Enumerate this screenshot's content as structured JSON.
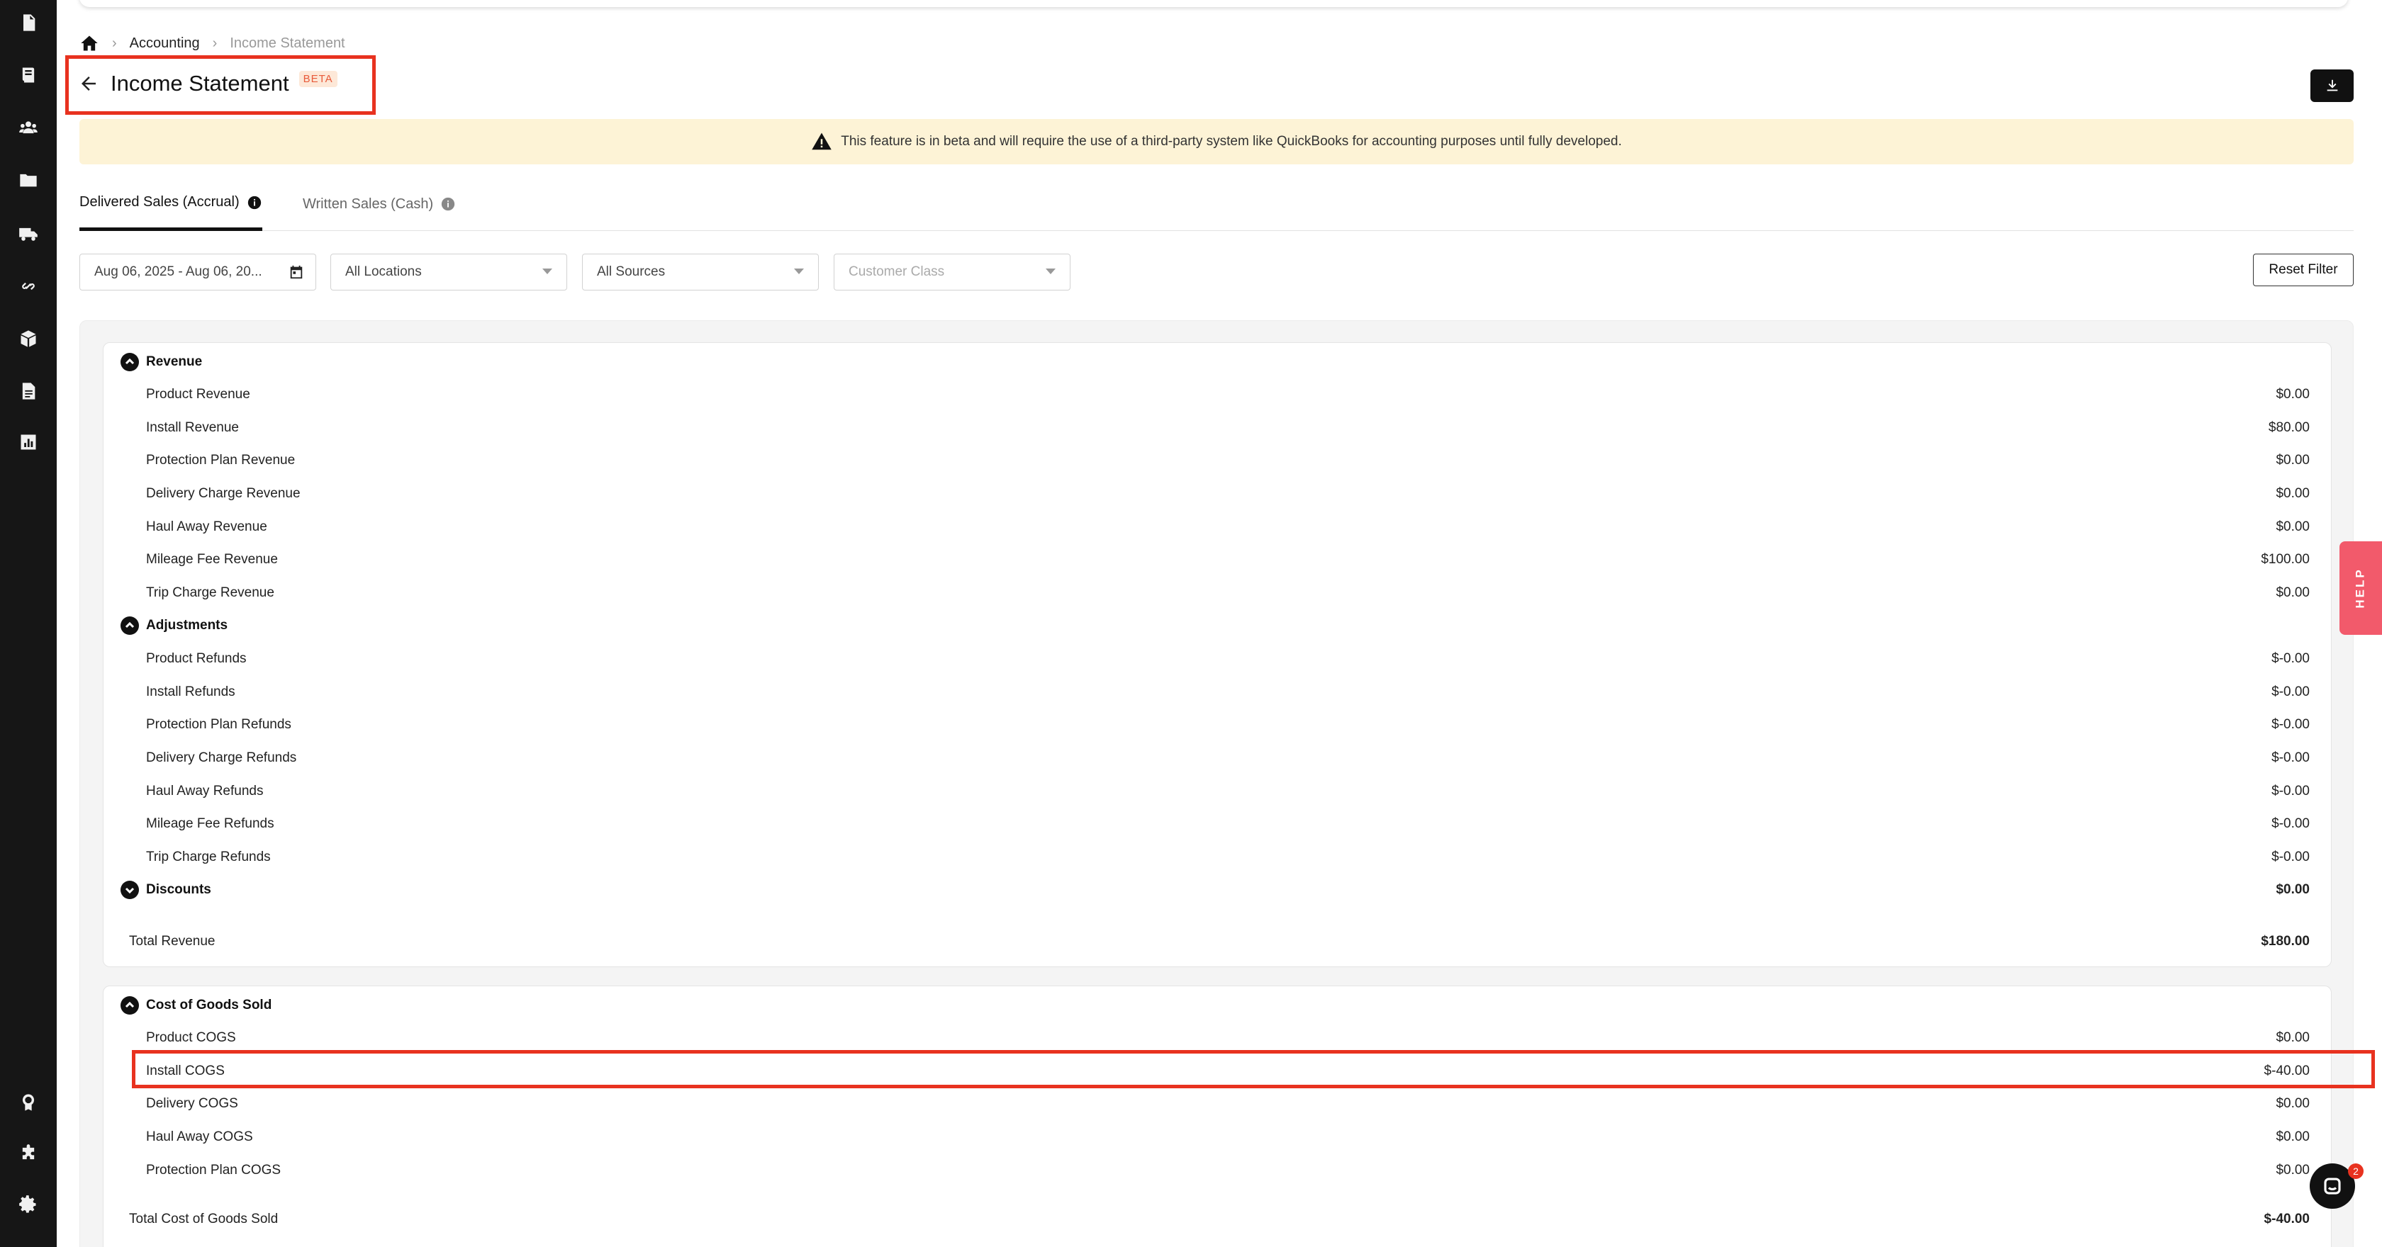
{
  "breadcrumb": {
    "level1": "Accounting",
    "level2": "Income Statement"
  },
  "header": {
    "title": "Income Statement",
    "badge": "BETA"
  },
  "banner": {
    "text": "This feature is in beta and will require the use of a third-party system like QuickBooks for accounting purposes until fully developed."
  },
  "tabs": [
    {
      "label": "Delivered Sales (Accrual)",
      "active": true
    },
    {
      "label": "Written Sales (Cash)",
      "active": false
    }
  ],
  "filters": {
    "date_range": "Aug 06, 2025 - Aug 06, 20...",
    "locations": "All Locations",
    "sources": "All Sources",
    "customer_class_placeholder": "Customer Class",
    "reset_label": "Reset Filter"
  },
  "revenue": {
    "group_label": "Revenue",
    "items": [
      {
        "label": "Product Revenue",
        "value": "$0.00"
      },
      {
        "label": "Install Revenue",
        "value": "$80.00"
      },
      {
        "label": "Protection Plan Revenue",
        "value": "$0.00"
      },
      {
        "label": "Delivery Charge Revenue",
        "value": "$0.00"
      },
      {
        "label": "Haul Away Revenue",
        "value": "$0.00"
      },
      {
        "label": "Mileage Fee Revenue",
        "value": "$100.00"
      },
      {
        "label": "Trip Charge Revenue",
        "value": "$0.00"
      }
    ],
    "adjustments_label": "Adjustments",
    "adjustments": [
      {
        "label": "Product Refunds",
        "value": "$-0.00"
      },
      {
        "label": "Install Refunds",
        "value": "$-0.00"
      },
      {
        "label": "Protection Plan Refunds",
        "value": "$-0.00"
      },
      {
        "label": "Delivery Charge Refunds",
        "value": "$-0.00"
      },
      {
        "label": "Haul Away Refunds",
        "value": "$-0.00"
      },
      {
        "label": "Mileage Fee Refunds",
        "value": "$-0.00"
      },
      {
        "label": "Trip Charge Refunds",
        "value": "$-0.00"
      }
    ],
    "discounts_label": "Discounts",
    "discounts_value": "$0.00",
    "total_label": "Total Revenue",
    "total_value": "$180.00"
  },
  "cogs": {
    "group_label": "Cost of Goods Sold",
    "items": [
      {
        "label": "Product COGS",
        "value": "$0.00"
      },
      {
        "label": "Install COGS",
        "value": "$-40.00"
      },
      {
        "label": "Delivery COGS",
        "value": "$0.00"
      },
      {
        "label": "Haul Away COGS",
        "value": "$0.00"
      },
      {
        "label": "Protection Plan COGS",
        "value": "$0.00"
      }
    ],
    "total_label": "Total Cost of Goods Sold",
    "total_value": "$-40.00"
  },
  "help": {
    "label": "HELP"
  },
  "chat": {
    "badge": "2"
  },
  "colors": {
    "highlight": "#e8321f",
    "banner_bg": "#fdf3d6",
    "sidebar_bg": "#161616",
    "help_bg": "#f25a6b"
  }
}
